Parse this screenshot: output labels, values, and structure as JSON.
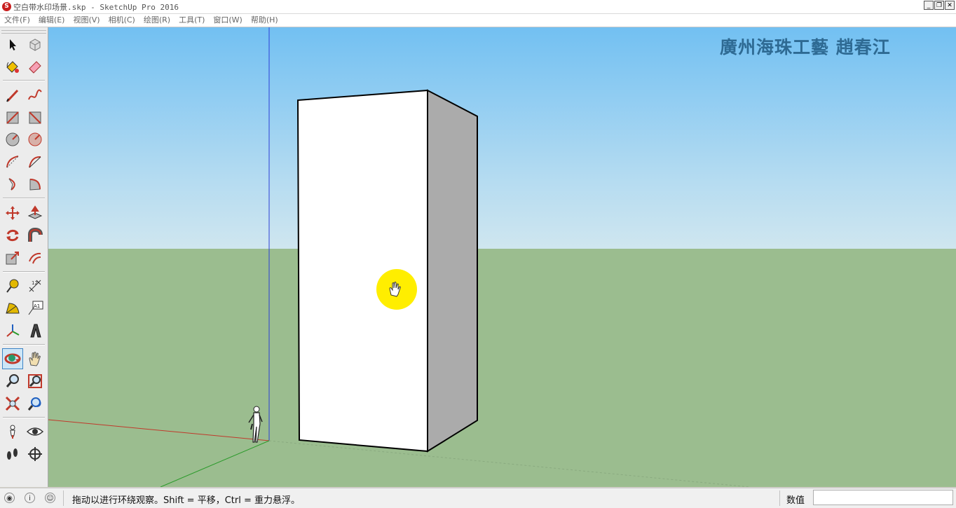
{
  "window": {
    "title": "空白带水印场景.skp - SketchUp Pro 2016",
    "app_icon": "sketchup-icon",
    "controls": [
      "_",
      "❐",
      "✕"
    ]
  },
  "menu": {
    "items": [
      "文件(F)",
      "编辑(E)",
      "视图(V)",
      "相机(C)",
      "绘图(R)",
      "工具(T)",
      "窗口(W)",
      "帮助(H)"
    ]
  },
  "toolbar": {
    "active_tool": "orbit",
    "text_tool_label": "A1",
    "tools": [
      "select-icon",
      "make-component-icon",
      "paint-bucket-icon",
      "eraser-icon",
      "line-icon",
      "freehand-icon",
      "rectangle-icon",
      "rotated-rectangle-icon",
      "circle-icon",
      "polygon-icon",
      "arc-icon",
      "two-point-arc-icon",
      "three-point-arc-icon",
      "pie-icon",
      "move-icon",
      "push-pull-icon",
      "rotate-icon",
      "follow-me-icon",
      "scale-icon",
      "offset-icon",
      "tape-measure-icon",
      "dimension-icon",
      "protractor-icon",
      "text-icon",
      "axes-icon",
      "3d-text-icon",
      "orbit-icon",
      "pan-icon",
      "zoom-icon",
      "zoom-window-icon",
      "zoom-extents-icon",
      "previous-view-icon",
      "position-camera-icon",
      "look-around-icon",
      "walk-icon",
      "section-plane-icon"
    ]
  },
  "viewport": {
    "watermark": "廣州海珠工藝  趙春江",
    "cursor": "pan-hand-icon",
    "colors": {
      "sky_top": "#72c0f2",
      "ground": "#9bbd8f",
      "highlight": "#ffee00"
    }
  },
  "status": {
    "icons": [
      "geolocation-icon",
      "info-icon",
      "user-icon"
    ],
    "message": "拖动以进行环绕观察。Shift = 平移，Ctrl = 重力悬浮。",
    "measurements_label": "数值",
    "measurements_value": ""
  }
}
